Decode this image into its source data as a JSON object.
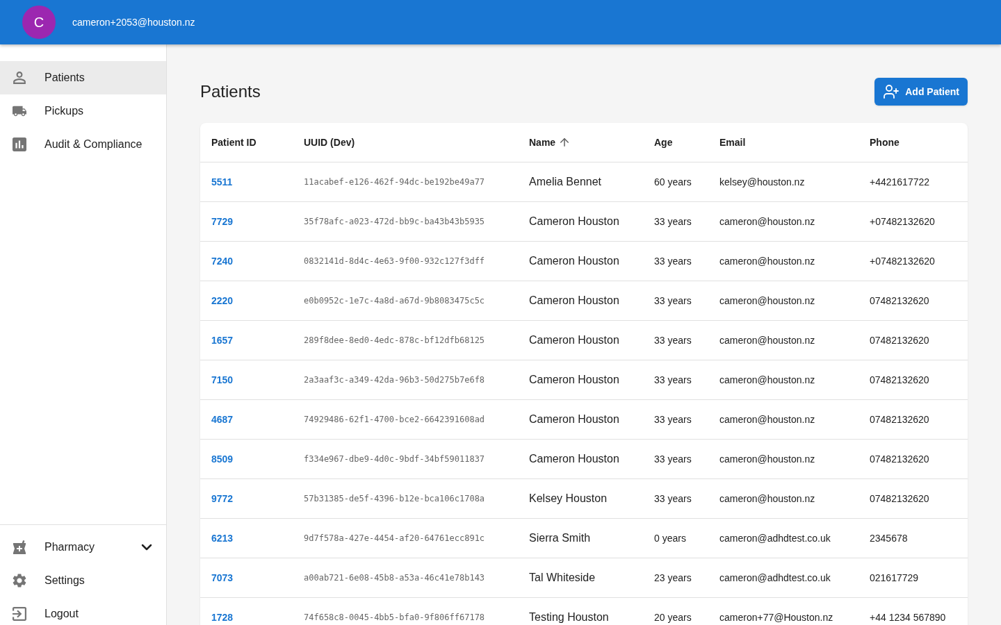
{
  "header": {
    "avatar": {
      "initial": "C"
    },
    "email": "cameron+2053@houston.nz"
  },
  "sidebar": {
    "items": [
      {
        "label": "Patients",
        "selected": true
      },
      {
        "label": "Pickups",
        "selected": false
      },
      {
        "label": "Audit & Compliance",
        "selected": false
      }
    ],
    "bottom_items": [
      {
        "label": "Pharmacy",
        "selected": false,
        "expanded": false
      },
      {
        "label": "Settings",
        "selected": false
      },
      {
        "label": "Logout",
        "selected": false
      }
    ]
  },
  "page": {
    "title": "Patients",
    "add_button": {
      "label": "Add Patient"
    }
  },
  "table": {
    "columns": [
      {
        "label": "Patient ID",
        "sorted": false
      },
      {
        "label": "UUID (Dev)",
        "sorted": false
      },
      {
        "label": "Name",
        "sorted": true
      },
      {
        "label": "Age",
        "sorted": false
      },
      {
        "label": "Email",
        "sorted": false
      },
      {
        "label": "Phone",
        "sorted": false
      }
    ],
    "rows": [
      {
        "patient_id": "5511",
        "uuid": "11acabef-e126-462f-94dc-be192be49a77",
        "name": "Amelia Bennet",
        "age": "60 years",
        "email": "kelsey@houston.nz",
        "phone": "+4421617722"
      },
      {
        "patient_id": "7729",
        "uuid": "35f78afc-a023-472d-bb9c-ba43b43b5935",
        "name": "Cameron Houston",
        "age": "33 years",
        "email": "cameron@houston.nz",
        "phone": "+07482132620"
      },
      {
        "patient_id": "7240",
        "uuid": "0832141d-8d4c-4e63-9f00-932c127f3dff",
        "name": "Cameron Houston",
        "age": "33 years",
        "email": "cameron@houston.nz",
        "phone": "+07482132620"
      },
      {
        "patient_id": "2220",
        "uuid": "e0b0952c-1e7c-4a8d-a67d-9b8083475c5c",
        "name": "Cameron Houston",
        "age": "33 years",
        "email": "cameron@houston.nz",
        "phone": "07482132620"
      },
      {
        "patient_id": "1657",
        "uuid": "289f8dee-8ed0-4edc-878c-bf12dfb68125",
        "name": "Cameron Houston",
        "age": "33 years",
        "email": "cameron@houston.nz",
        "phone": "07482132620"
      },
      {
        "patient_id": "7150",
        "uuid": "2a3aaf3c-a349-42da-96b3-50d275b7e6f8",
        "name": "Cameron Houston",
        "age": "33 years",
        "email": "cameron@houston.nz",
        "phone": "07482132620"
      },
      {
        "patient_id": "4687",
        "uuid": "74929486-62f1-4700-bce2-6642391608ad",
        "name": "Cameron Houston",
        "age": "33 years",
        "email": "cameron@houston.nz",
        "phone": "07482132620"
      },
      {
        "patient_id": "8509",
        "uuid": "f334e967-dbe9-4d0c-9bdf-34bf59011837",
        "name": "Cameron Houston",
        "age": "33 years",
        "email": "cameron@houston.nz",
        "phone": "07482132620"
      },
      {
        "patient_id": "9772",
        "uuid": "57b31385-de5f-4396-b12e-bca106c1708a",
        "name": "Kelsey Houston",
        "age": "33 years",
        "email": "cameron@houston.nz",
        "phone": "07482132620"
      },
      {
        "patient_id": "6213",
        "uuid": "9d7f578a-427e-4454-af20-64761ecc891c",
        "name": "Sierra Smith",
        "age": "0 years",
        "email": "cameron@adhdtest.co.uk",
        "phone": "2345678"
      },
      {
        "patient_id": "7073",
        "uuid": "a00ab721-6e08-45b8-a53a-46c41e78b143",
        "name": "Tal Whiteside",
        "age": "23 years",
        "email": "cameron@adhdtest.co.uk",
        "phone": "021617729"
      },
      {
        "patient_id": "1728",
        "uuid": "74f658c8-0045-4bb5-bfa0-9f806ff67178",
        "name": "Testing Houston",
        "age": "20 years",
        "email": "cameron+77@Houston.nz",
        "phone": "+44 1234 567890"
      }
    ]
  }
}
